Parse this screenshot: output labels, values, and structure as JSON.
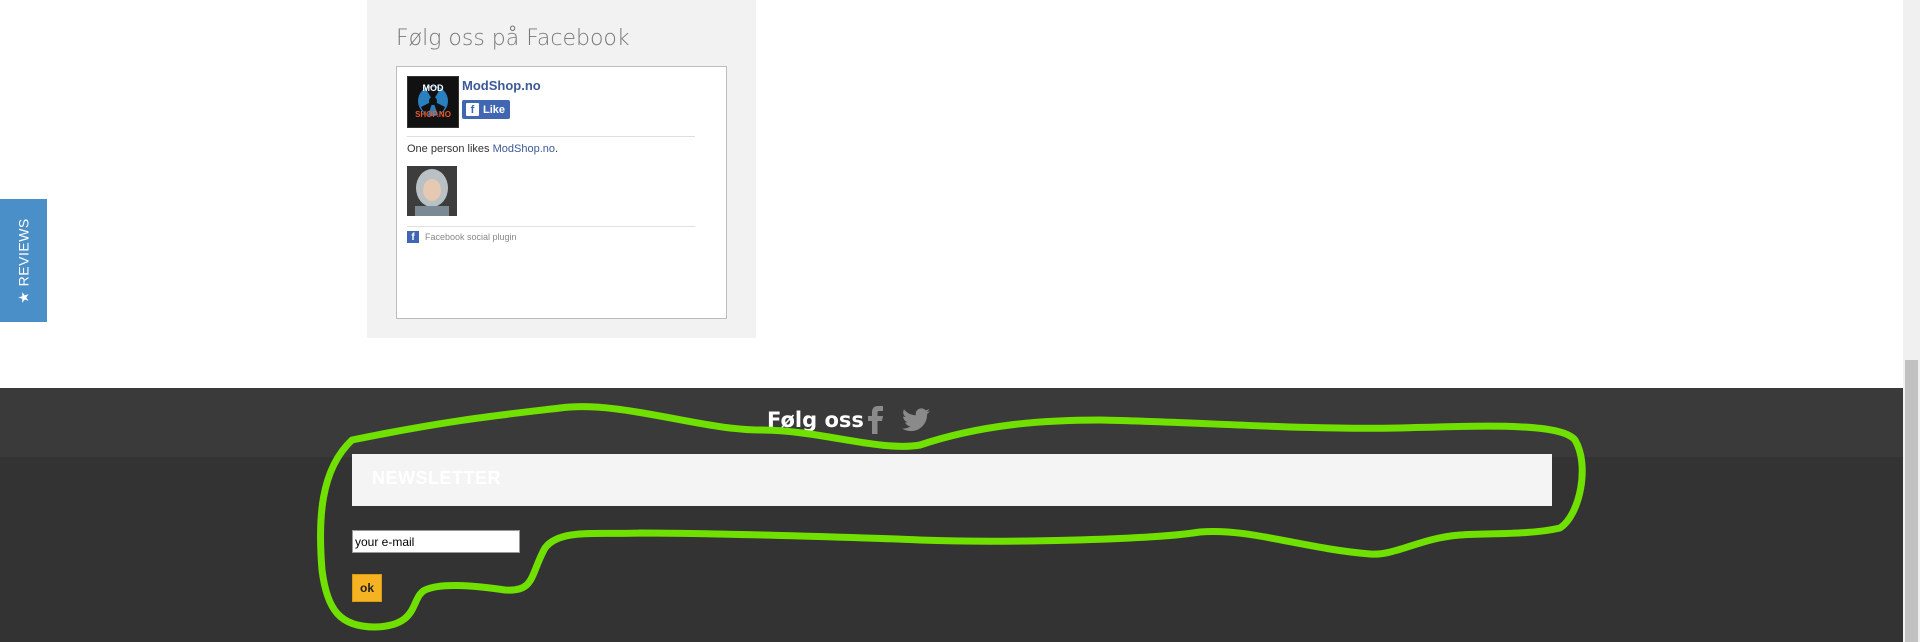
{
  "reviews_tab": {
    "label": "★ REVIEWS",
    "color": "#4a8fc7"
  },
  "facebook_widget": {
    "title": "Følg oss på Facebook",
    "page_name": "ModShop.no",
    "like_label": "Like",
    "likes_prefix": "One person likes ",
    "likes_link": "ModShop.no",
    "likes_suffix": ".",
    "plugin_label": "Facebook social plugin",
    "logo_text": [
      "MOD",
      "SHOP.NO"
    ]
  },
  "footer": {
    "follow_title": "Følg oss",
    "social_icons": [
      "facebook-icon",
      "twitter-icon"
    ],
    "newsletter": {
      "title": "NEWSLETTER",
      "email_value": "your e-mail",
      "ok_label": "ok"
    }
  },
  "colors": {
    "footer_top": "#3a3a3a",
    "footer_main": "#333333",
    "highlight": "#6fe000",
    "ok_button": "#f5b323",
    "facebook_blue": "#4267b2"
  }
}
